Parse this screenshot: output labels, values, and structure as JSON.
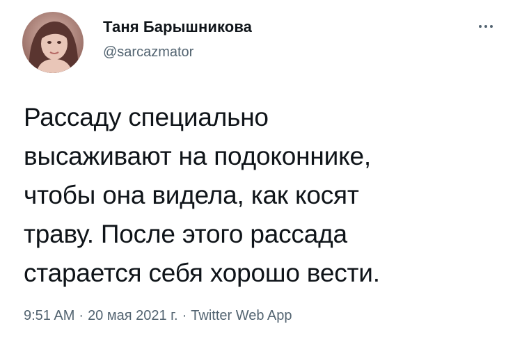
{
  "author": {
    "display_name": "Таня Барышникова",
    "handle": "@sarcazmator",
    "avatar_icon": "profile-photo-icon"
  },
  "more_icon": "more-dots-icon",
  "tweet": {
    "lines": [
      "Рассаду специально",
      "высаживают на подоконнике,",
      "чтобы она видела, как косят",
      "траву. После этого рассада",
      "старается себя хорошо вести."
    ]
  },
  "meta": {
    "time": "9:51 AM",
    "date": "20 мая 2021 г.",
    "source": "Twitter Web App",
    "separator": "·"
  },
  "colors": {
    "text": "#0f1419",
    "secondary": "#536471",
    "background": "#ffffff"
  }
}
